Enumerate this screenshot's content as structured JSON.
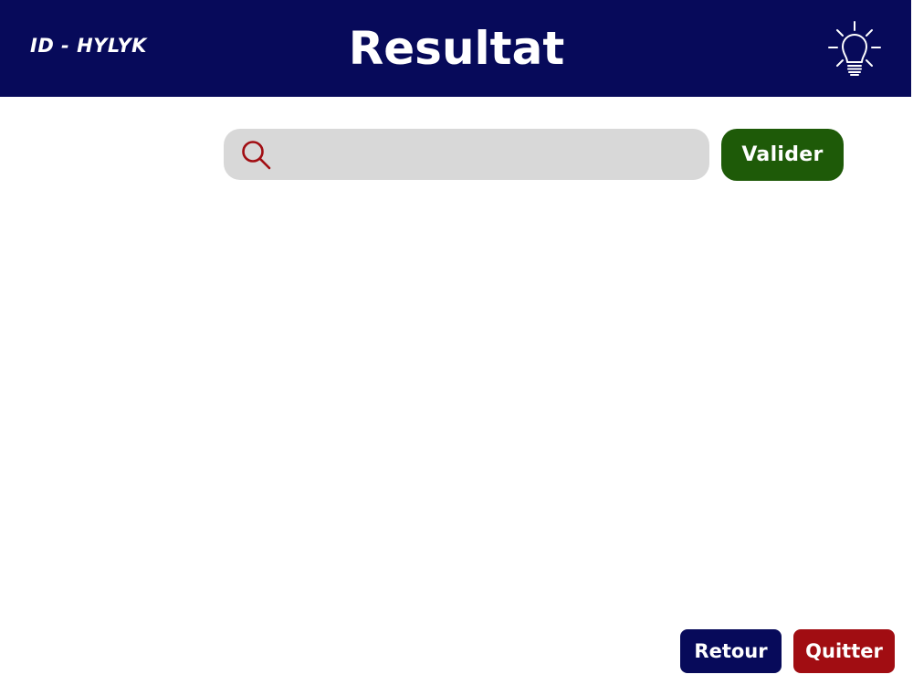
{
  "header": {
    "session_id": "ID - HYLYK",
    "title": "Resultat",
    "hint_icon": "lightbulb-icon",
    "background_color": "#070a5a"
  },
  "search": {
    "icon": "search-icon",
    "icon_color": "#a10d12",
    "value": "",
    "placeholder": ""
  },
  "actions": {
    "validate_label": "Valider",
    "validate_color": "#1e5a08"
  },
  "footer": {
    "back_label": "Retour",
    "back_color": "#070a5a",
    "quit_label": "Quitter",
    "quit_color": "#a10d12"
  }
}
